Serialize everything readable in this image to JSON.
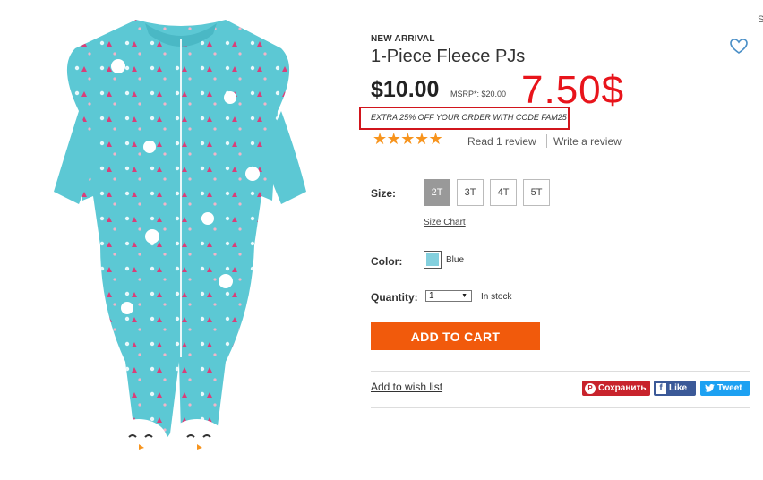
{
  "product": {
    "badge": "NEW ARRIVAL",
    "title": "1-Piece Fleece PJs",
    "price": "$10.00",
    "msrp": "MSRP*: $20.00",
    "promo": "EXTRA 25% OFF YOUR ORDER WITH CODE FAM25",
    "annotation": "7.50$",
    "stars": "★★★★★",
    "rating": 5,
    "read_review": "Read 1 review",
    "write_review": "Write a review",
    "corner_text": "S"
  },
  "size": {
    "label": "Size:",
    "options": [
      "2T",
      "3T",
      "4T",
      "5T"
    ],
    "selected": "2T",
    "chart_link": "Size Chart"
  },
  "color": {
    "label": "Color:",
    "name": "Blue",
    "swatch_color": "#83d0de"
  },
  "quantity": {
    "label": "Quantity:",
    "value": "1",
    "stock": "In stock"
  },
  "actions": {
    "add_to_cart": "ADD TO CART",
    "wishlist": "Add to wish list"
  },
  "share": {
    "pinterest": "Сохранить",
    "facebook": "Like",
    "twitter": "Tweet"
  },
  "colors": {
    "accent": "#f15a0c",
    "annotation": "#e8141b",
    "fabric": "#5cc8d4"
  }
}
